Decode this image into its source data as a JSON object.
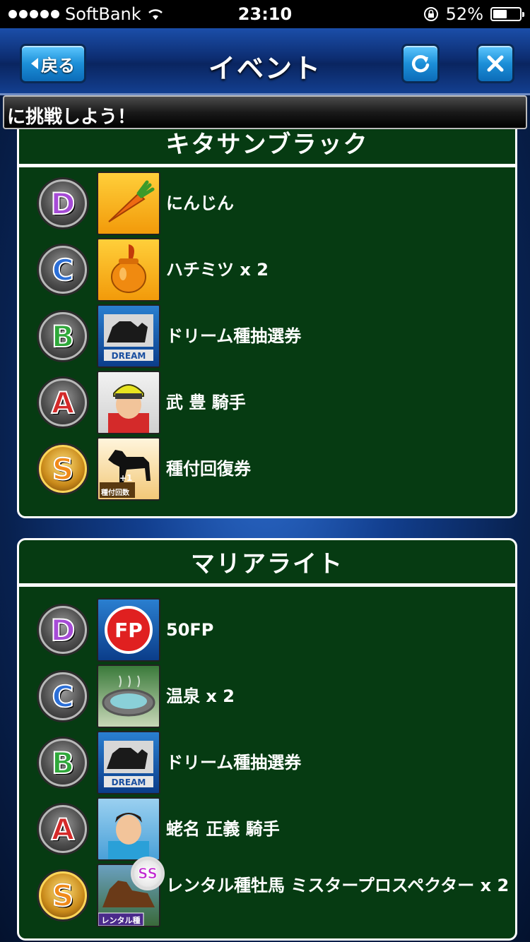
{
  "status_bar": {
    "carrier": "SoftBank",
    "time": "23:10",
    "battery_percent": "52%",
    "battery_level": 0.52
  },
  "header": {
    "back_label": "戻る",
    "title": "イベント",
    "refresh_icon": "refresh-icon",
    "close_icon": "close-icon"
  },
  "ticker": {
    "text": "に挑戦しよう！"
  },
  "panels": [
    {
      "title": "キタサンブラック",
      "rewards": [
        {
          "rank": "D",
          "item": "にんじん",
          "icon": "carrot-icon"
        },
        {
          "rank": "C",
          "item": "ハチミツ x 2",
          "icon": "honey-icon"
        },
        {
          "rank": "B",
          "item": "ドリーム種抽選券",
          "icon": "dream-ticket-icon"
        },
        {
          "rank": "A",
          "item": "武 豊 騎手",
          "icon": "jockey-portrait-icon"
        },
        {
          "rank": "S",
          "item": "種付回復券",
          "icon": "horse-silhouette-icon"
        }
      ]
    },
    {
      "title": "マリアライト",
      "rewards": [
        {
          "rank": "D",
          "item": "50FP",
          "icon": "fp-icon"
        },
        {
          "rank": "C",
          "item": "温泉 x 2",
          "icon": "hot-spring-icon"
        },
        {
          "rank": "B",
          "item": "ドリーム種抽選券",
          "icon": "dream-ticket-icon"
        },
        {
          "rank": "A",
          "item": "蛯名 正義 騎手",
          "icon": "jockey-portrait-icon"
        },
        {
          "rank": "S",
          "item": "レンタル種牡馬 ミスタープロスペクター x 2",
          "icon": "stallion-icon"
        }
      ]
    }
  ],
  "icon_labels": {
    "dream": "DREAM",
    "fp": "FP",
    "plus_one": "+1",
    "breeding_count": "種付回数",
    "rental": "レンタル種",
    "ss": "SS"
  },
  "colors": {
    "panel_bg": "#063b12",
    "rank_d": "#a64bd6",
    "rank_c": "#2c6fd6",
    "rank_b": "#2fa83a",
    "rank_a": "#d42a2a",
    "rank_s": "#f08a1a"
  }
}
